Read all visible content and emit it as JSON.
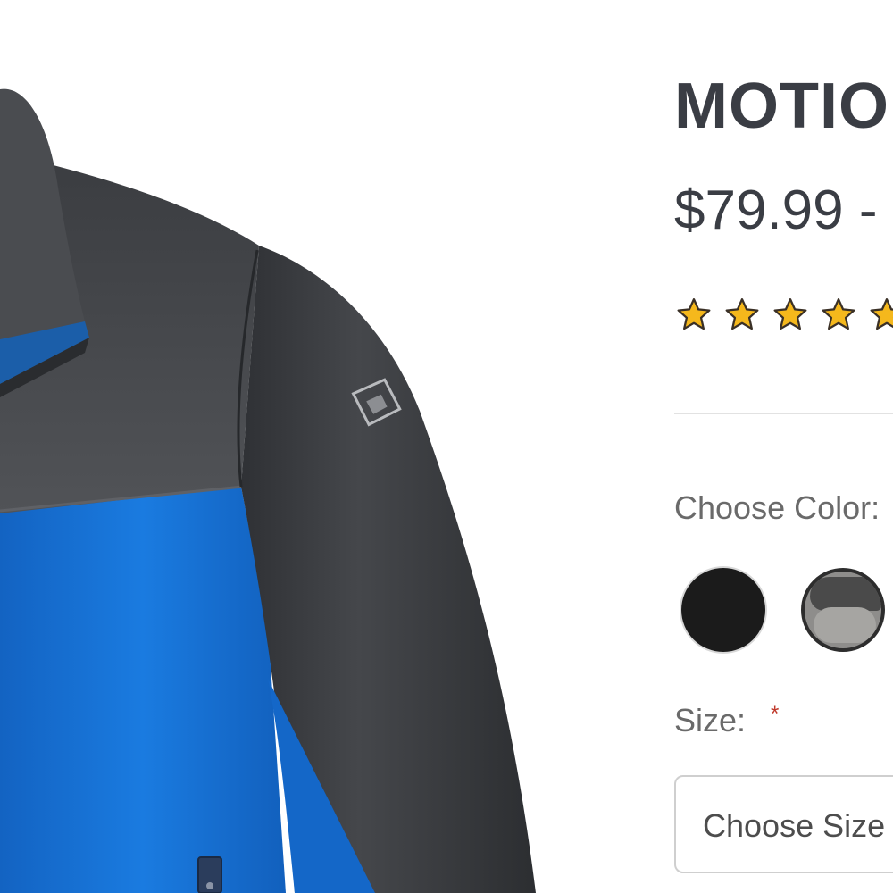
{
  "product": {
    "title": "MOTIO",
    "price": "$79.99 -",
    "rating": {
      "stars_shown": 5,
      "visible_star_count": 5
    },
    "image_alt": "jacket-product-photo"
  },
  "options": {
    "color_label": "Choose Color:",
    "color_swatches": [
      {
        "name": "black-swatch",
        "color": "#1b1b1b"
      },
      {
        "name": "grey-swatch",
        "color": "#8e8d8b"
      }
    ],
    "size_label": "Size:",
    "required_marker": "*",
    "size_select_placeholder": "Choose Size"
  },
  "colors": {
    "jacket_blue": "#1473d3",
    "jacket_charcoal": "#3d3f43",
    "star_fill": "#f5b81c",
    "star_stroke": "#3a3026",
    "text_dark": "#3a3d44"
  }
}
